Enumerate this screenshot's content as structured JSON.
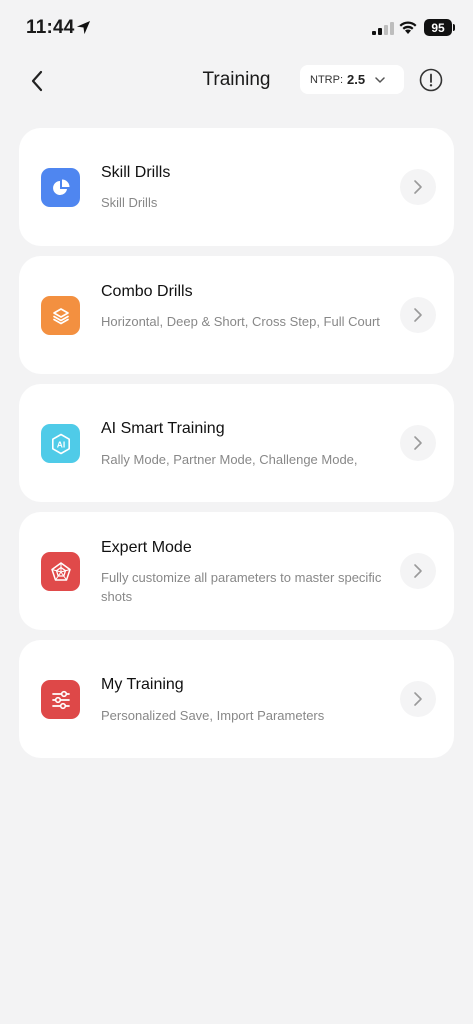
{
  "status_bar": {
    "time": "11:44",
    "battery": "95"
  },
  "header": {
    "title": "Training",
    "ntrp_label": "NTRP:",
    "ntrp_value": "2.5"
  },
  "cards": [
    {
      "title": "Skill Drills",
      "description": "Skill Drills",
      "icon": "pie-chart-icon",
      "color": "#4f86f0"
    },
    {
      "title": "Combo Drills",
      "description": "Horizontal, Deep & Short, Cross Step, Full Court",
      "icon": "layers-icon",
      "color": "#f39040"
    },
    {
      "title": "AI Smart Training",
      "description": "Rally Mode, Partner Mode, Challenge Mode,",
      "icon": "ai-icon",
      "color": "#4fcbe8"
    },
    {
      "title": "Expert Mode",
      "description": "Fully customize all parameters to master specific shots",
      "icon": "radar-icon",
      "color": "#e04a4a"
    },
    {
      "title": "My Training",
      "description": "Personalized Save, Import Parameters",
      "icon": "sliders-icon",
      "color": "#de4848"
    }
  ]
}
